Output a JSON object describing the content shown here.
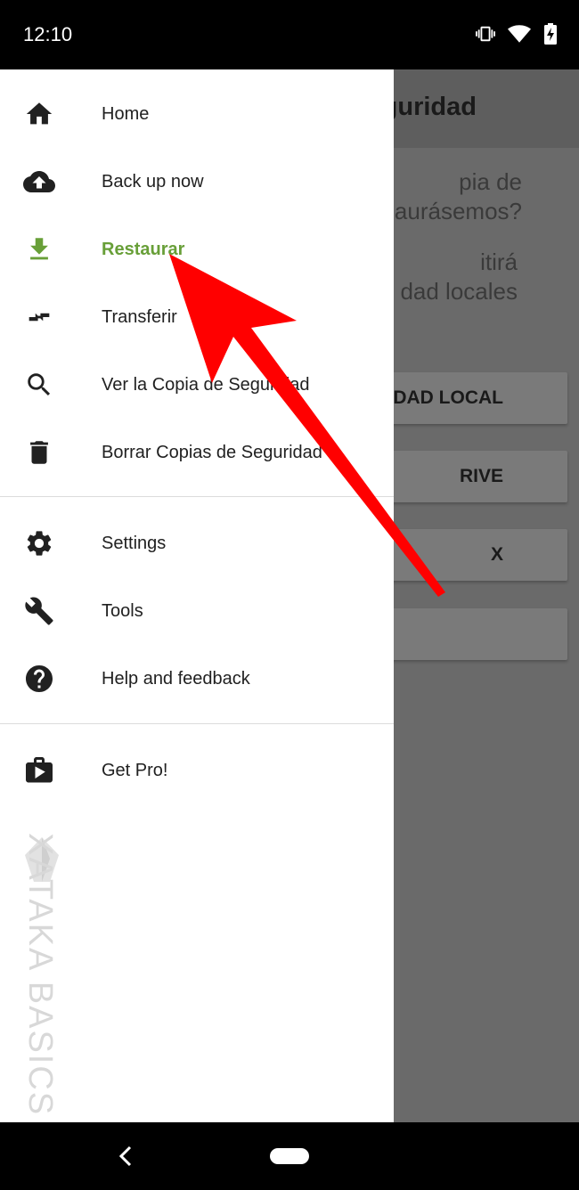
{
  "status_bar": {
    "time": "12:10",
    "icons": [
      "vibrate-icon",
      "wifi-icon",
      "battery-charging-icon"
    ]
  },
  "background_app": {
    "title_fragment": "guridad",
    "question_lines": [
      "pia de",
      "aurásemos?"
    ],
    "description_lines": [
      "itirá",
      "dad locales"
    ],
    "buttons": [
      "IDAD LOCAL",
      "RIVE",
      "X",
      ""
    ]
  },
  "drawer": {
    "primary_items": [
      {
        "label": "Home",
        "icon": "home-icon"
      },
      {
        "label": "Back up now",
        "icon": "cloud-upload-icon"
      },
      {
        "label": "Restaurar",
        "icon": "download-icon",
        "active": true
      },
      {
        "label": "Transferir",
        "icon": "transfer-arrows-icon"
      },
      {
        "label": "Ver la Copia de Seguridad",
        "icon": "search-icon"
      },
      {
        "label": "Borrar Copias de Seguridad",
        "icon": "trash-icon"
      }
    ],
    "secondary_items": [
      {
        "label": "Settings",
        "icon": "gear-icon"
      },
      {
        "label": "Tools",
        "icon": "wrench-icon"
      },
      {
        "label": "Help and feedback",
        "icon": "help-icon"
      }
    ],
    "tertiary_items": [
      {
        "label": "Get Pro!",
        "icon": "play-store-bag-icon"
      }
    ]
  },
  "watermark": "XATAKA BASICS",
  "colors": {
    "active": "#689f38",
    "arrow": "#ff0000",
    "scrim": "#6a6a6a",
    "icon": "#212121"
  }
}
